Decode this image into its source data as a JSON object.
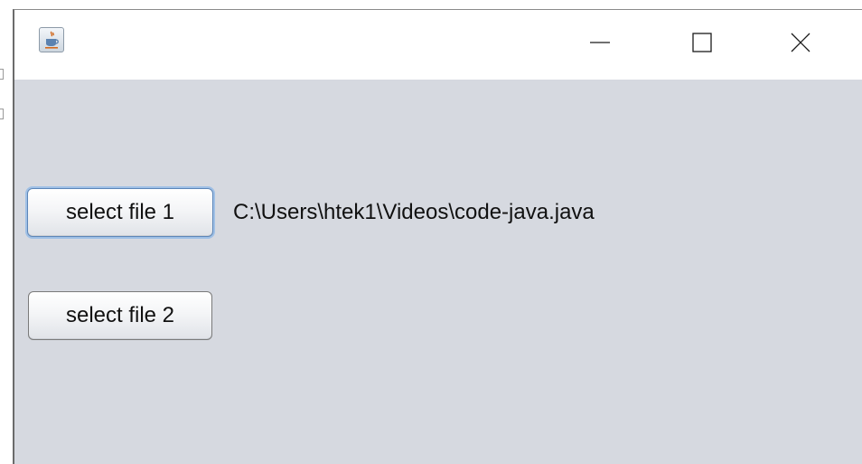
{
  "window": {
    "controls": {
      "minimize_icon": "minimize-icon",
      "maximize_icon": "maximize-icon",
      "close_icon": "close-icon"
    },
    "app_icon": "java-cup-icon"
  },
  "content": {
    "button_1_label": "select file 1",
    "button_2_label": "select file 2",
    "file_1_path": "C:\\Users\\htek1\\Videos\\code-java.java"
  },
  "colors": {
    "content_background": "#d6d9e0",
    "titlebar_background": "#ffffff",
    "focus_ring": "#9fc0e6"
  }
}
